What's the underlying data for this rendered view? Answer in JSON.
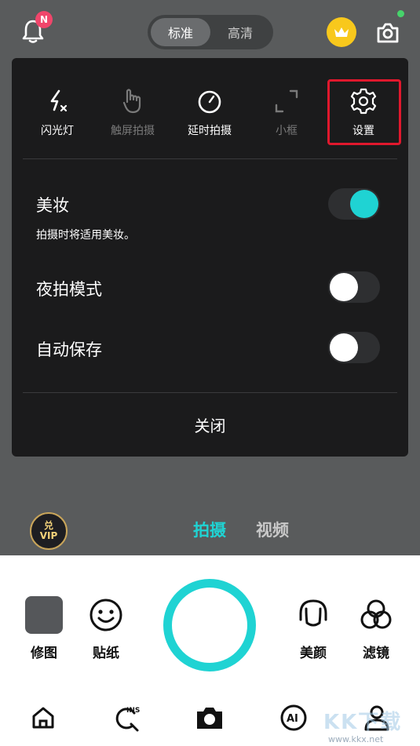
{
  "top_bar": {
    "badge": "N",
    "quality": {
      "standard": "标准",
      "hd": "高清",
      "selected": "标准"
    }
  },
  "tools": [
    {
      "label": "闪光灯",
      "icon": "flash-off-icon",
      "enabled": true
    },
    {
      "label": "触屏拍摄",
      "icon": "touch-shoot-icon",
      "enabled": false
    },
    {
      "label": "延时拍摄",
      "icon": "timer-icon",
      "enabled": true
    },
    {
      "label": "小框",
      "icon": "small-frame-icon",
      "enabled": false
    },
    {
      "label": "设置",
      "icon": "gear-icon",
      "enabled": true,
      "highlighted": true
    }
  ],
  "settings": {
    "makeup": {
      "title": "美妆",
      "subtitle": "拍摄时将适用美妆。",
      "on": true
    },
    "night": {
      "title": "夜拍模式",
      "on": false
    },
    "autosave": {
      "title": "自动保存",
      "on": false
    },
    "close_label": "关闭"
  },
  "vip": {
    "line1": "兑",
    "line2": "VIP"
  },
  "modes": {
    "photo": "拍摄",
    "video": "视频",
    "active": "拍摄"
  },
  "controls": {
    "edit": "修图",
    "sticker": "贴纸",
    "beauty": "美颜",
    "filter": "滤镜"
  },
  "watermark": {
    "text": "KK下载",
    "url": "www.kkx.net"
  },
  "colors": {
    "accent": "#1fd3d3",
    "highlight": "#e0182d",
    "crown": "#f8c81c"
  }
}
